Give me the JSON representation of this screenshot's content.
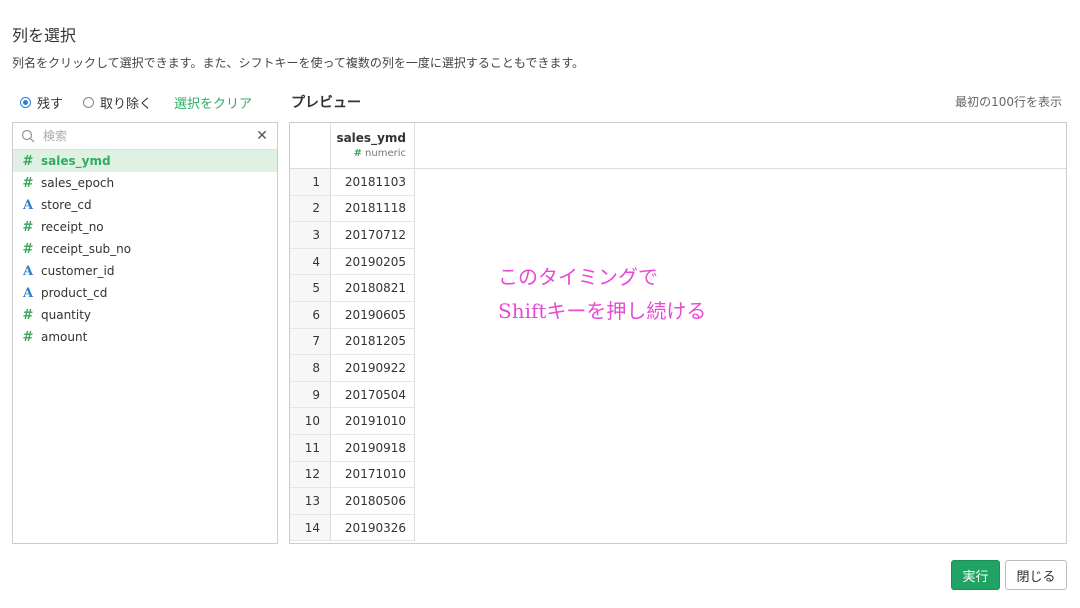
{
  "dialog": {
    "title": "列を選択",
    "description": "列名をクリックして選択できます。また、シフトキーを使って複数の列を一度に選択することもできます。"
  },
  "mode": {
    "keep_label": "残す",
    "remove_label": "取り除く",
    "clear_label": "選択をクリア",
    "selected": "keep"
  },
  "search": {
    "placeholder": "検索",
    "value": ""
  },
  "columns": [
    {
      "name": "sales_ymd",
      "type": "numeric",
      "icon": "#",
      "selected": true
    },
    {
      "name": "sales_epoch",
      "type": "numeric",
      "icon": "#",
      "selected": false
    },
    {
      "name": "store_cd",
      "type": "character",
      "icon": "A",
      "selected": false
    },
    {
      "name": "receipt_no",
      "type": "numeric",
      "icon": "#",
      "selected": false
    },
    {
      "name": "receipt_sub_no",
      "type": "numeric",
      "icon": "#",
      "selected": false
    },
    {
      "name": "customer_id",
      "type": "character",
      "icon": "A",
      "selected": false
    },
    {
      "name": "product_cd",
      "type": "character",
      "icon": "A",
      "selected": false
    },
    {
      "name": "quantity",
      "type": "numeric",
      "icon": "#",
      "selected": false
    },
    {
      "name": "amount",
      "type": "numeric",
      "icon": "#",
      "selected": false
    }
  ],
  "preview": {
    "title": "プレビュー",
    "rows_note": "最初の100行を表示",
    "column": {
      "name": "sales_ymd",
      "type": "numeric"
    },
    "rows": [
      {
        "index": "1",
        "value": "20181103"
      },
      {
        "index": "2",
        "value": "20181118"
      },
      {
        "index": "3",
        "value": "20170712"
      },
      {
        "index": "4",
        "value": "20190205"
      },
      {
        "index": "5",
        "value": "20180821"
      },
      {
        "index": "6",
        "value": "20190605"
      },
      {
        "index": "7",
        "value": "20181205"
      },
      {
        "index": "8",
        "value": "20190922"
      },
      {
        "index": "9",
        "value": "20170504"
      },
      {
        "index": "10",
        "value": "20191010"
      },
      {
        "index": "11",
        "value": "20190918"
      },
      {
        "index": "12",
        "value": "20171010"
      },
      {
        "index": "13",
        "value": "20180506"
      },
      {
        "index": "14",
        "value": "20190326"
      }
    ]
  },
  "annotation": {
    "line1": "このタイミングで",
    "line2": "Shiftキーを押し続ける"
  },
  "buttons": {
    "run": "実行",
    "close": "閉じる"
  },
  "colors": {
    "accent_green": "#1fa463",
    "annotation_pink": "#e84ad6",
    "selected_bg": "#dff1e3",
    "radio_blue": "#2f80d1"
  }
}
